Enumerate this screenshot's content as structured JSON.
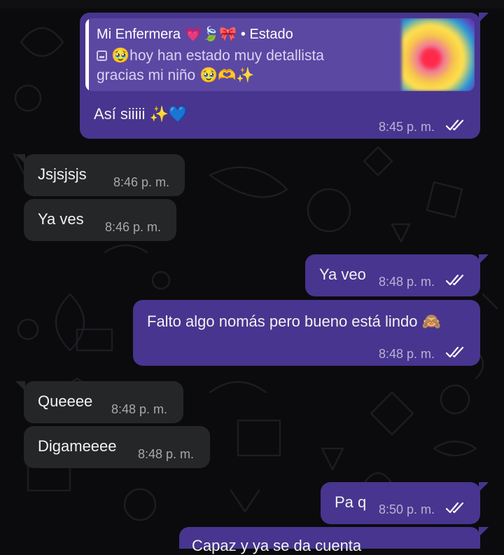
{
  "chat": {
    "messages": [
      {
        "direction": "outgoing",
        "reply_to": {
          "author": "Mi Enfermera 💗🍃🎀",
          "separator": " • ",
          "source": "Estado",
          "line1": "🥹hoy han estado muy detallista",
          "line2": "gracias mi niño 🥹🫶✨"
        },
        "text": "Así siiiii ✨💙",
        "time": "8:45 p. m.",
        "status": "read"
      },
      {
        "direction": "incoming",
        "text": "Jsjsjsjs",
        "time": "8:46 p. m."
      },
      {
        "direction": "incoming",
        "text": "Ya ves",
        "time": "8:46 p. m."
      },
      {
        "direction": "outgoing",
        "text": "Ya veo",
        "time": "8:48 p. m.",
        "status": "read"
      },
      {
        "direction": "outgoing",
        "text": "Falto algo nomás pero bueno está lindo 🙈",
        "time": "8:48 p. m.",
        "status": "read"
      },
      {
        "direction": "incoming",
        "text": "Queeee",
        "time": "8:48 p. m."
      },
      {
        "direction": "incoming",
        "text": "Digameeee",
        "time": "8:48 p. m."
      },
      {
        "direction": "outgoing",
        "text": "Pa q",
        "time": "8:50 p. m.",
        "status": "read"
      },
      {
        "direction": "outgoing",
        "text": "Capaz y ya se da cuenta",
        "time": "",
        "status": "partial"
      }
    ]
  },
  "colors": {
    "background": "#0b0b0d",
    "outgoing_bubble": "#47358f",
    "incoming_bubble": "#242628",
    "quote_background": "#5a48a3",
    "read_ticks": "#ffffff"
  },
  "icons": [
    "image-icon",
    "double-check-icon",
    "status-thumbnail"
  ]
}
